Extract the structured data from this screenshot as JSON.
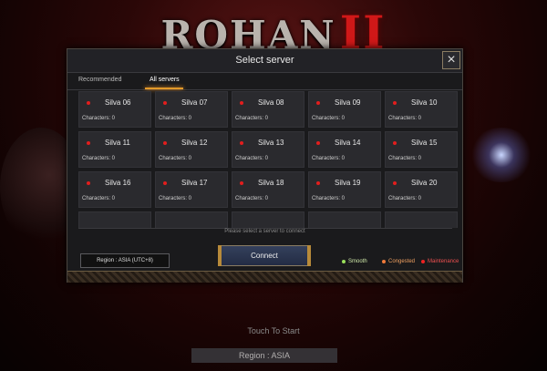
{
  "logo": {
    "text": "ROHAN",
    "numeral": "II"
  },
  "dialog": {
    "title": "Select server",
    "close_icon": "×",
    "tabs": [
      "Recommended",
      "All servers"
    ],
    "hint": "Please select a server to connect",
    "region_button": "Region : ASIA (UTC+8)",
    "connect_button": "Connect",
    "legend": [
      {
        "label": "Smooth",
        "color": "#9adf5a"
      },
      {
        "label": "Congested",
        "color": "#f07a3a"
      },
      {
        "label": "Maintenance",
        "color": "#ee2222"
      }
    ]
  },
  "servers": [
    {
      "name": "Silva 06",
      "characters": "Characters: 0",
      "status": "maintenance"
    },
    {
      "name": "Silva 07",
      "characters": "Characters: 0",
      "status": "maintenance"
    },
    {
      "name": "Silva 08",
      "characters": "Characters: 0",
      "status": "maintenance"
    },
    {
      "name": "Silva 09",
      "characters": "Characters: 0",
      "status": "maintenance"
    },
    {
      "name": "Silva 10",
      "characters": "Characters: 0",
      "status": "maintenance"
    },
    {
      "name": "Silva 11",
      "characters": "Characters: 0",
      "status": "maintenance"
    },
    {
      "name": "Silva 12",
      "characters": "Characters: 0",
      "status": "maintenance"
    },
    {
      "name": "Silva 13",
      "characters": "Characters: 0",
      "status": "maintenance"
    },
    {
      "name": "Silva 14",
      "characters": "Characters: 0",
      "status": "maintenance"
    },
    {
      "name": "Silva 15",
      "characters": "Characters: 0",
      "status": "maintenance"
    },
    {
      "name": "Silva 16",
      "characters": "Characters: 0",
      "status": "maintenance"
    },
    {
      "name": "Silva 17",
      "characters": "Characters: 0",
      "status": "maintenance"
    },
    {
      "name": "Silva 18",
      "characters": "Characters: 0",
      "status": "maintenance"
    },
    {
      "name": "Silva 19",
      "characters": "Characters: 0",
      "status": "maintenance"
    },
    {
      "name": "Silva 20",
      "characters": "Characters: 0",
      "status": "maintenance"
    },
    {
      "name": "",
      "characters": "",
      "status": ""
    },
    {
      "name": "",
      "characters": "",
      "status": ""
    },
    {
      "name": "",
      "characters": "",
      "status": ""
    },
    {
      "name": "",
      "characters": "",
      "status": ""
    },
    {
      "name": "",
      "characters": "",
      "status": ""
    }
  ],
  "footer": {
    "touch_to_start": "Touch To Start",
    "region": "Region : ASIA"
  }
}
